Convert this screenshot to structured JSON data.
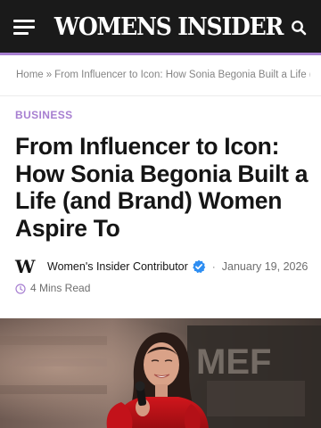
{
  "header": {
    "logo_text": "WOMENS INSIDER",
    "menu_icon": "hamburger-menu-icon",
    "search_icon": "search-icon",
    "background_color": "#1a1a1a",
    "accent_color": "#a77fd1"
  },
  "breadcrumb": {
    "home": "Home",
    "separator": "»",
    "current": "From Influencer to Icon: How Sonia Begonia Built a Life (a..."
  },
  "article": {
    "category": "BUSINESS",
    "headline": "From Influencer to Icon: How Sonia Begonia Built a Life (and Brand) Women Aspire To",
    "author_logo": "W",
    "author": "Women's Insider Contributor",
    "verified_icon": "verified-badge-icon",
    "date_separator": "·",
    "date": "January 19, 2026",
    "read_time_icon": "clock-icon",
    "read_time": "4 Mins Read"
  },
  "hero_image": {
    "description_icon": "featured-photo",
    "sign_text": "MEF"
  }
}
